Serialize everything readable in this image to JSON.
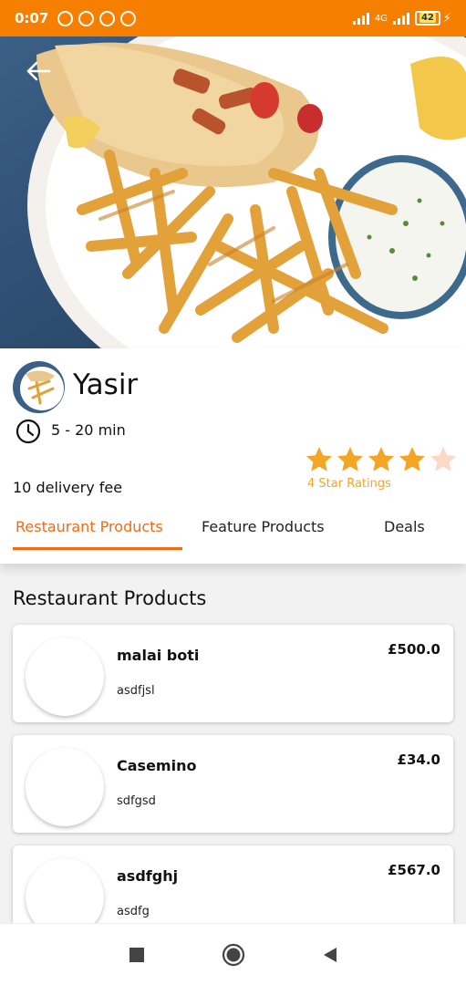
{
  "status_bar": {
    "time": "0:07",
    "network": "4G",
    "battery": "42"
  },
  "restaurant": {
    "name": "Yasir",
    "delivery_time": "5 - 20 min",
    "delivery_fee": "10 delivery fee",
    "rating": 4,
    "rating_max": 5,
    "rating_label": "4 Star Ratings"
  },
  "tabs": [
    {
      "label": "Restaurant Products",
      "active": true
    },
    {
      "label": "Feature Products",
      "active": false
    },
    {
      "label": "Deals",
      "active": false
    }
  ],
  "section_title": "Restaurant Products",
  "products": [
    {
      "name": "malai boti",
      "description": "asdfjsl",
      "price": "£500.0"
    },
    {
      "name": "Casemino",
      "description": "sdfgsd",
      "price": "£34.0"
    },
    {
      "name": "asdfghj",
      "description": "asdfg",
      "price": "£567.0"
    }
  ],
  "colors": {
    "status_bar": "#f77f00",
    "accent": "#f26a14",
    "star": "#f5a524",
    "star_empty": "#fcd9c4"
  },
  "icons": {
    "back": "arrow-left-icon",
    "clock": "clock-icon",
    "star": "star-icon",
    "nav": [
      "square-icon",
      "circle-home-icon",
      "triangle-back-icon"
    ]
  }
}
